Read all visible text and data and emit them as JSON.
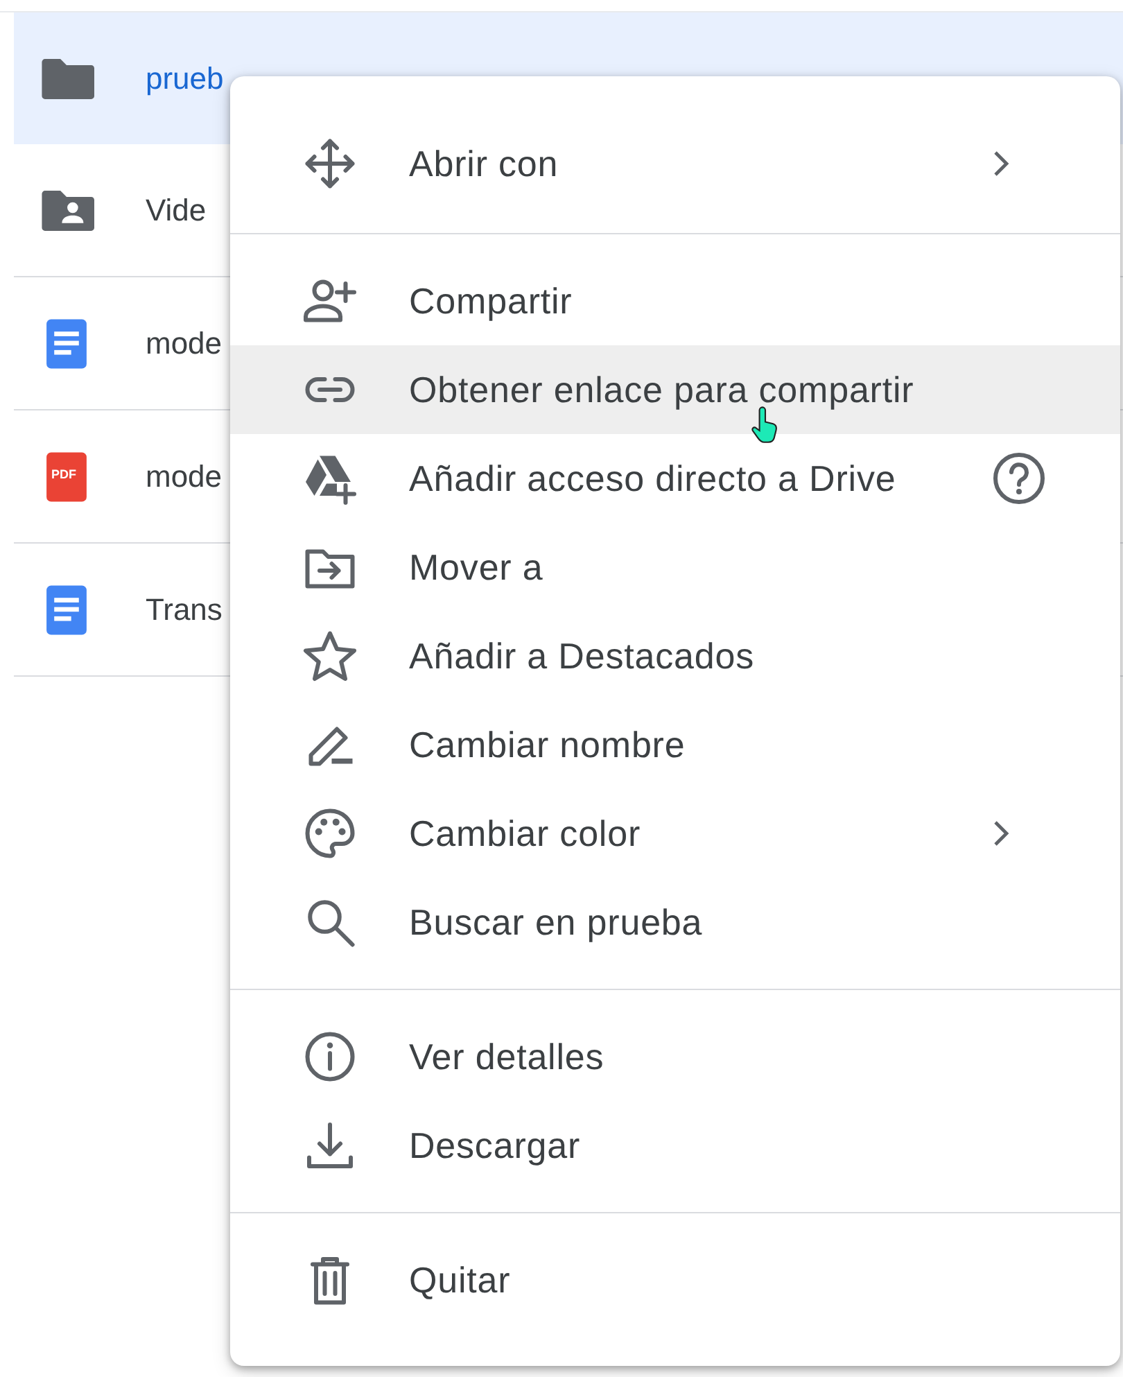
{
  "files": [
    {
      "kind": "folder",
      "name": "prueb",
      "selected": true
    },
    {
      "kind": "shared-folder",
      "name": "Vide",
      "selected": false
    },
    {
      "kind": "doc",
      "name": "mode",
      "selected": false
    },
    {
      "kind": "pdf",
      "name": "mode",
      "badge": "PDF",
      "selected": false
    },
    {
      "kind": "doc",
      "name": "Trans",
      "selected": false
    }
  ],
  "context_menu": {
    "sections": [
      [
        {
          "label": "Abrir con",
          "submenu": true,
          "highlighted": false
        }
      ],
      [
        {
          "label": "Compartir",
          "submenu": false,
          "highlighted": false
        },
        {
          "label": "Obtener enlace para compartir",
          "submenu": false,
          "highlighted": true
        },
        {
          "label": "Añadir acceso directo a Drive",
          "submenu": false,
          "help": true,
          "highlighted": false
        },
        {
          "label": "Mover a",
          "submenu": false,
          "highlighted": false
        },
        {
          "label": "Añadir a Destacados",
          "submenu": false,
          "highlighted": false
        },
        {
          "label": "Cambiar nombre",
          "submenu": false,
          "highlighted": false
        },
        {
          "label": "Cambiar color",
          "submenu": true,
          "highlighted": false
        },
        {
          "label": "Buscar en prueba",
          "submenu": false,
          "highlighted": false
        }
      ],
      [
        {
          "label": "Ver detalles",
          "submenu": false,
          "highlighted": false
        },
        {
          "label": "Descargar",
          "submenu": false,
          "highlighted": false
        }
      ],
      [
        {
          "label": "Quitar",
          "submenu": false,
          "highlighted": false
        }
      ]
    ]
  }
}
